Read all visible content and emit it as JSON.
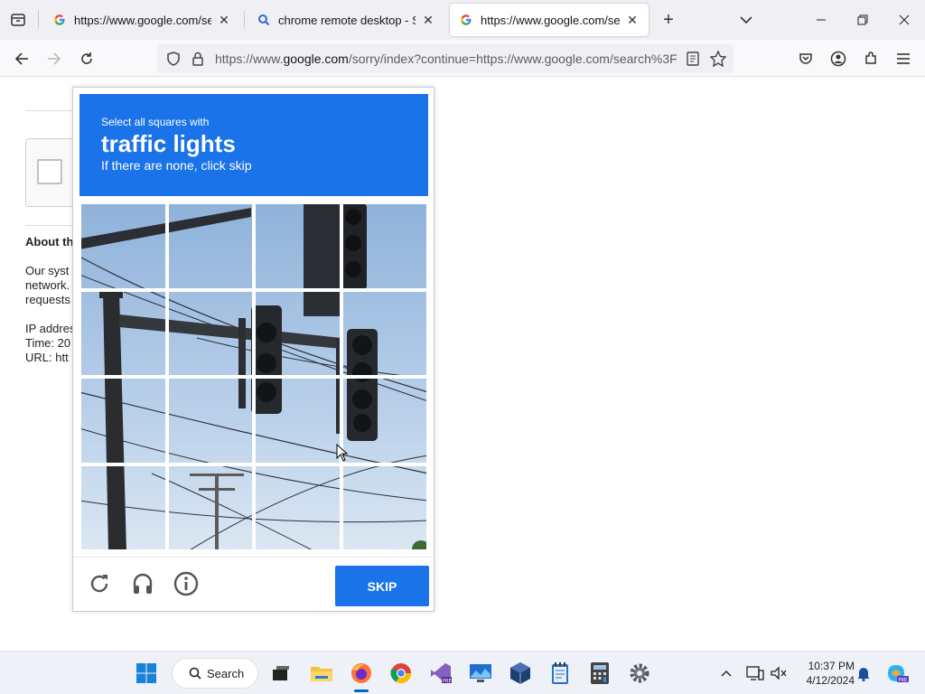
{
  "browser": {
    "tabs": [
      {
        "title": "https://www.google.com/search",
        "favicon": "google-icon",
        "active": false
      },
      {
        "title": "chrome remote desktop - Search",
        "favicon": "search-icon",
        "active": false
      },
      {
        "title": "https://www.google.com/search",
        "favicon": "google-icon",
        "active": true
      }
    ],
    "url_prefix": "https://www.",
    "url_domain": "google.com",
    "url_rest": "/sorry/index?continue=https://www.google.com/search%3F",
    "accent": "#1a73e8"
  },
  "page": {
    "about_heading": "About th",
    "about_lines": [
      "Our syst",
      "network.",
      "requests"
    ],
    "meta_lines": [
      "IP addres",
      "Time: 20",
      "URL: htt"
    ]
  },
  "captcha": {
    "line1": "Select all squares with",
    "line2": "traffic lights",
    "line3": "If there are none, click skip",
    "skip_label": "SKIP",
    "header_color": "#1a73e8"
  },
  "taskbar": {
    "search_label": "Search",
    "time": "10:37 PM",
    "date": "4/12/2024"
  }
}
